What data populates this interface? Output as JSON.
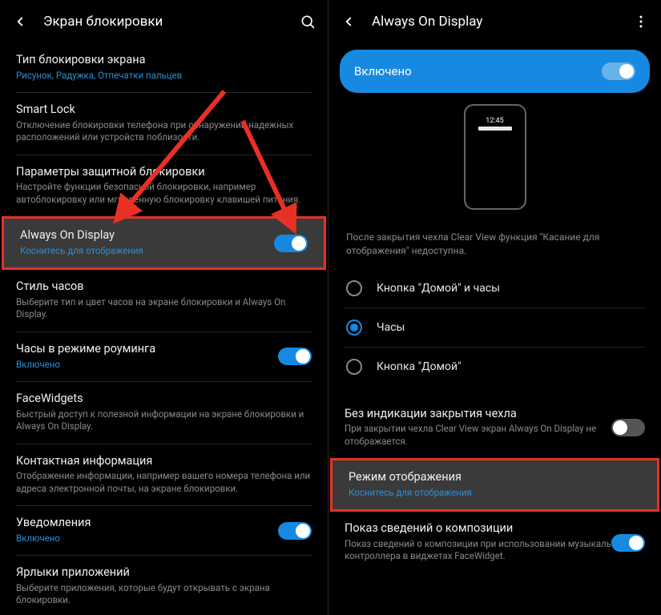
{
  "left": {
    "title": "Экран блокировки",
    "items": [
      {
        "title": "Тип блокировки экрана",
        "desc": "Рисунок, Радужка, Отпечатки пальцев",
        "descLink": true
      },
      {
        "title": "Smart Lock",
        "desc": "Отключение блокировки телефона при обнаружении надежных расположений или устройств поблизости."
      },
      {
        "title": "Параметры защитной блокировки",
        "desc": "Настройте функции безопасной блокировки, например автоблокировку или мгновенную блокировку клавишей питания."
      },
      {
        "title": "Always On Display",
        "desc": "Коснитесь для отображения",
        "descLink": true,
        "toggle": true,
        "highlight": true
      },
      {
        "title": "Стиль часов",
        "desc": "Выберите тип и цвет часов на экране блокировки и Always On Display."
      },
      {
        "title": "Часы в режиме роуминга",
        "desc": "Включено",
        "descLink": true,
        "toggle": true
      },
      {
        "title": "FaceWidgets",
        "desc": "Быстрый доступ к полезной информации на экране блокировки и Always On Display."
      },
      {
        "title": "Контактная информация",
        "desc": "Отображение информации, например вашего номера телефона или адреса электронной почты, на экране блокировки."
      },
      {
        "title": "Уведомления",
        "desc": "Включено",
        "descLink": true,
        "toggle": true
      },
      {
        "title": "Ярлыки приложений",
        "desc": "Выберите приложения, которые будут открывать с экрана блокировки."
      }
    ]
  },
  "right": {
    "title": "Always On Display",
    "masterToggle": "Включено",
    "previewTime": "12:45",
    "note": "После закрытия чехла Clear View функция \"Касание для отображения\" недоступна.",
    "radios": [
      {
        "label": "Кнопка \"Домой\" и часы",
        "selected": false
      },
      {
        "label": "Часы",
        "selected": true
      },
      {
        "label": "Кнопка \"Домой\"",
        "selected": false
      }
    ],
    "items": [
      {
        "title": "Без индикации закрытия чехла",
        "desc": "При закрытии чехла Clear View экран Always On Display не отображается.",
        "toggle": true,
        "toggleOn": false
      },
      {
        "title": "Режим отображения",
        "desc": "Коснитесь для отображения",
        "descLink": true,
        "highlight": true
      },
      {
        "title": "Показ сведений о композиции",
        "desc": "Показ сведений о композиции при использовании музыкального контроллера в виджетах FaceWidget.",
        "toggle": true,
        "toggleOn": true
      }
    ]
  }
}
